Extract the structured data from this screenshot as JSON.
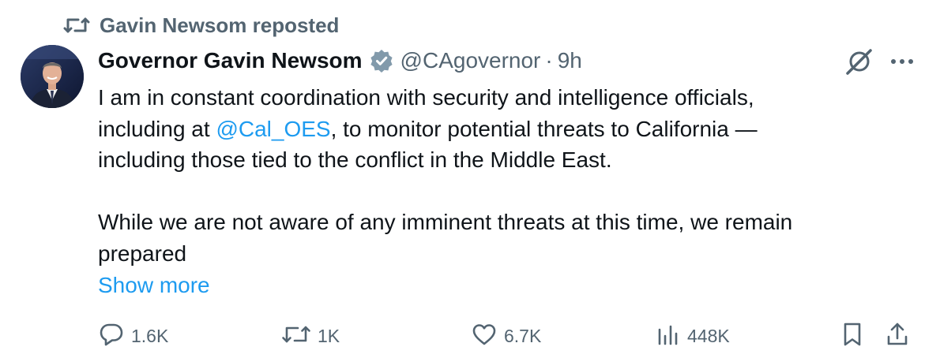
{
  "repost": {
    "label": "Gavin Newsom reposted",
    "icon": "repost-icon"
  },
  "author": {
    "name": "Governor Gavin Newsom",
    "handle": "@CAgovernor",
    "separator": "·",
    "time": "9h",
    "verified": true,
    "verified_color": "#829aab"
  },
  "post": {
    "lines": [
      "I am in constant coordination with security and intelligence officials,",
      "including at ",
      ", to monitor potential threats to California —",
      "including those tied to the conflict in the Middle East.",
      "While we are not aware of any imminent threats at this time, we remain",
      "prepared"
    ],
    "mention": "@Cal_OES",
    "show_more": "Show more"
  },
  "actions": {
    "replies": "1.6K",
    "reposts": "1K",
    "likes": "6.7K",
    "views": "448K"
  },
  "colors": {
    "text": "#0f1419",
    "secondary": "#536471",
    "link": "#1d9bf0"
  }
}
